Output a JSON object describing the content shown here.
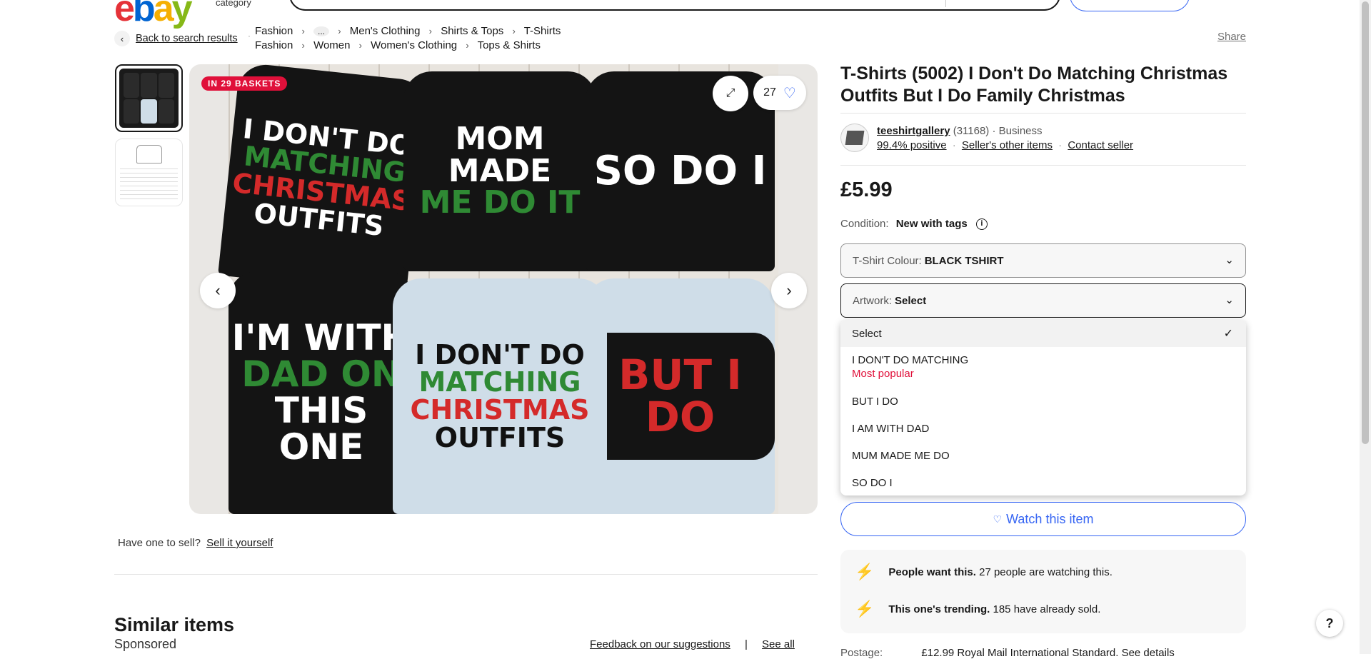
{
  "header": {
    "logo": [
      "e",
      "b",
      "a",
      "y"
    ],
    "shop_by_category": "category"
  },
  "breadcrumb": {
    "back_label": "Back to search results",
    "row1": [
      "Fashion",
      "...",
      "Men's Clothing",
      "Shirts & Tops",
      "T-Shirts"
    ],
    "row2": [
      "Fashion",
      "Women",
      "Women's Clothing",
      "Tops & Shirts"
    ],
    "share": "Share"
  },
  "gallery": {
    "badge": "IN 29 BASKETS",
    "watch_count": "27",
    "shirts": {
      "s1": [
        "I DON'T DO",
        "MATCHING",
        "CHRISTMAS",
        "OUTFITS"
      ],
      "s2": [
        "MOM MADE",
        "ME DO IT"
      ],
      "s3": [
        "SO DO I"
      ],
      "s4": [
        "I'M WITH",
        "DAD ON",
        "THIS ONE"
      ],
      "s5": [
        "I DON'T DO",
        "MATCHING",
        "CHRISTMAS",
        "OUTFITS"
      ],
      "s6": [
        "BUT I DO"
      ]
    },
    "sell_prompt": "Have one to sell?",
    "sell_link": "Sell it yourself"
  },
  "similar": {
    "title": "Similar items",
    "sponsored": "Sponsored",
    "feedback": "Feedback on our suggestions",
    "divider": "|",
    "see_all": "See all"
  },
  "item": {
    "title": "T-Shirts (5002) I Don't Do Matching Christmas Outfits But I Do Family Christmas",
    "seller_name": "teeshirtgallery",
    "seller_count": "(31168)",
    "seller_type": "· Business",
    "positive": "99.4% positive",
    "other_items": "Seller's other items",
    "contact": "Contact seller",
    "price": "£5.99",
    "condition_label": "Condition:",
    "condition_value": "New with tags",
    "colour_label": "T-Shirt Colour:",
    "colour_value": "BLACK TSHIRT",
    "artwork_label": "Artwork:",
    "artwork_value": "Select",
    "artwork_options": [
      "Select",
      "I DON'T DO MATCHING",
      "BUT I DO",
      "I AM WITH DAD",
      "MUM MADE ME DO",
      "SO DO I"
    ],
    "most_popular": "Most popular",
    "watch_button": "Watch this item",
    "promo1_bold": "People want this.",
    "promo1_text": "27 people are watching this.",
    "promo2_bold": "This one's trending.",
    "promo2_text": "185 have already sold.",
    "postage_label": "Postage:",
    "postage_text": "£12.99 Royal Mail International Standard. See details"
  },
  "colors": {
    "ebay_red": "#e53238",
    "ebay_blue": "#0064d2",
    "ebay_yellow": "#f5af02",
    "ebay_green": "#86b817",
    "accent_blue": "#3665f3",
    "badge_red": "#e0103a"
  }
}
